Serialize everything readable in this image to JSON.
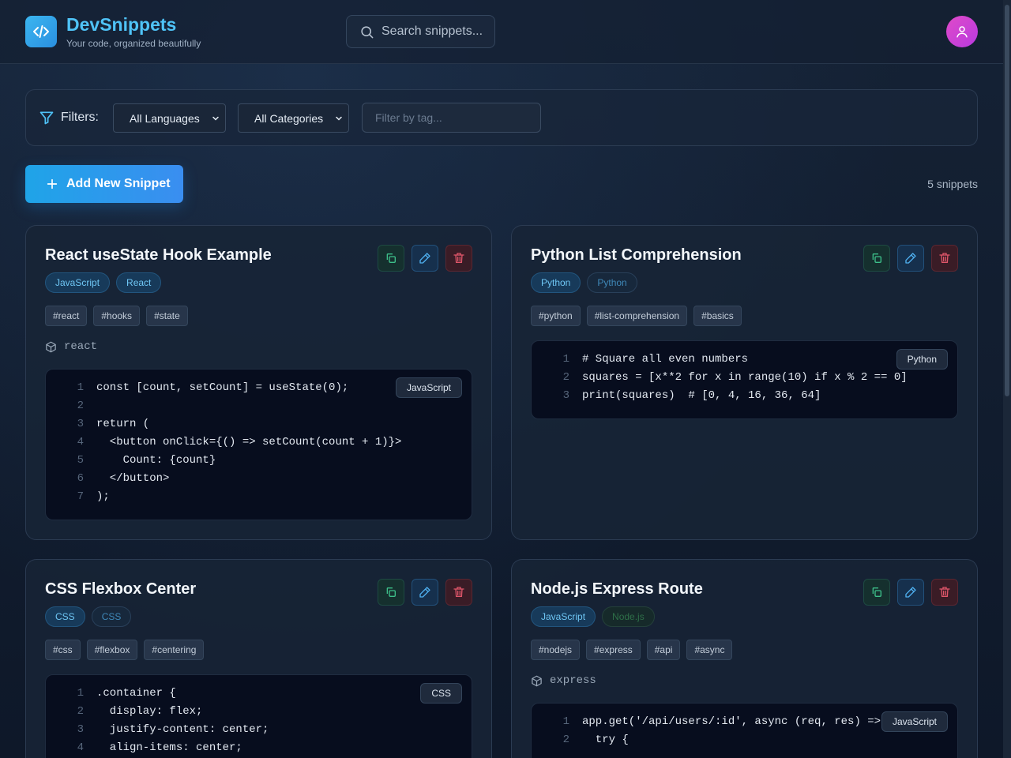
{
  "header": {
    "title": "DevSnippets",
    "subtitle": "Your code, organized beautifully",
    "search_placeholder": "Search snippets..."
  },
  "filters": {
    "label": "Filters:",
    "language": "All Languages",
    "category": "All Categories",
    "tag_placeholder": "Filter by tag..."
  },
  "toolbar": {
    "add_label": "Add New Snippet",
    "count": "5 snippets"
  },
  "colors": {
    "accent": "#4fc3f7",
    "primary_button": "#1fa4e8",
    "avatar": "#d444d0",
    "danger": "#e0566a"
  },
  "cards": [
    {
      "title": "React useState Hook Example",
      "badges": [
        "JavaScript",
        "React"
      ],
      "tags": [
        "#react",
        "#hooks",
        "#state"
      ],
      "dependency": "react",
      "lang": "JavaScript",
      "lines": [
        "const [count, setCount] = useState(0);",
        "",
        "return (",
        "  <button onClick={() => setCount(count + 1)}>",
        "    Count: {count}",
        "  </button>",
        ");"
      ]
    },
    {
      "title": "Python List Comprehension",
      "badges": [
        "Python",
        "Python"
      ],
      "tags": [
        "#python",
        "#list-comprehension",
        "#basics"
      ],
      "lang": "Python",
      "lines": [
        "# Square all even numbers",
        "squares = [x**2 for x in range(10) if x % 2 == 0]",
        "print(squares)  # [0, 4, 16, 36, 64]"
      ]
    },
    {
      "title": "CSS Flexbox Center",
      "badges": [
        "CSS",
        "CSS"
      ],
      "tags": [
        "#css",
        "#flexbox",
        "#centering"
      ],
      "lang": "CSS",
      "lines": [
        ".container {",
        "  display: flex;",
        "  justify-content: center;",
        "  align-items: center;"
      ]
    },
    {
      "title": "Node.js Express Route",
      "badges": [
        "JavaScript",
        "Node.js"
      ],
      "tags": [
        "#nodejs",
        "#express",
        "#api",
        "#async"
      ],
      "dependency": "express",
      "lang": "JavaScript",
      "lines": [
        "app.get('/api/users/:id', async (req, res) =>",
        "  try {"
      ]
    }
  ]
}
